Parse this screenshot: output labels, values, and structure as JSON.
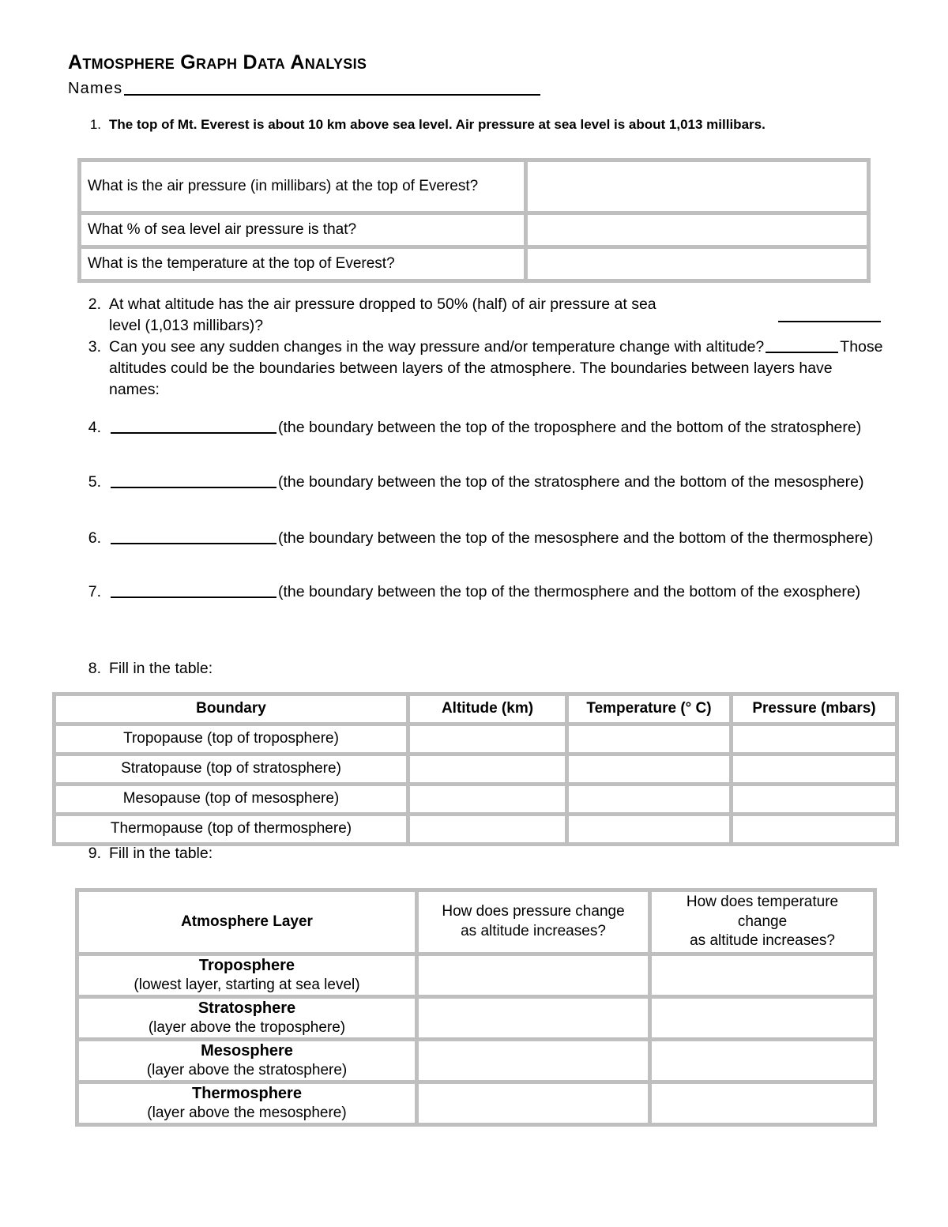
{
  "document": {
    "title": "Atmosphere Graph Data Analysis",
    "names_label": "Names"
  },
  "questions": {
    "q1": {
      "number": "1.",
      "text": "The top of Mt. Everest is about 10 km above sea level. Air pressure at sea level is about 1,013 millibars."
    },
    "q2": {
      "number": "2.",
      "line1": "At what altitude has the air pressure dropped to 50% (half) of air pressure at sea",
      "line2": "level (1,013 millibars)?"
    },
    "q3": {
      "number": "3.",
      "part1": "Can you see any sudden changes in the way pressure and/or temperature change with altitude?",
      "part2": "Those altitudes could be the boundaries between layers of the atmosphere. The boundaries between layers have names:"
    },
    "q4": {
      "number": "4.",
      "text": "(the boundary between the top of the troposphere and the bottom of the stratosphere)"
    },
    "q5": {
      "number": "5.",
      "text": "(the boundary between the top of the stratosphere and the bottom of the mesosphere)"
    },
    "q6": {
      "number": "6.",
      "text": "(the boundary between the top of the mesosphere and the bottom of the thermosphere)"
    },
    "q7": {
      "number": "7.",
      "text": "(the boundary between the top of the thermosphere and the bottom of the exosphere)"
    },
    "q8": {
      "number": "8.",
      "text": "Fill in the table:"
    },
    "q9": {
      "number": "9.",
      "text": "Fill in the table:"
    }
  },
  "everest_table": {
    "rows": [
      {
        "question": "What is the air pressure (in millibars) at the top of Everest?",
        "answer": ""
      },
      {
        "question": "What % of sea level air pressure is that?",
        "answer": ""
      },
      {
        "question": "What is the temperature at the top of Everest?",
        "answer": ""
      }
    ]
  },
  "boundary_table": {
    "headers": [
      "Boundary",
      "Altitude (km)",
      "Temperature (° C)",
      "Pressure (mbars)"
    ],
    "rows": [
      {
        "boundary": "Tropopause (top of troposphere)",
        "altitude": "",
        "temperature": "",
        "pressure": ""
      },
      {
        "boundary": "Stratopause (top of stratosphere)",
        "altitude": "",
        "temperature": "",
        "pressure": ""
      },
      {
        "boundary": "Mesopause (top of mesosphere)",
        "altitude": "",
        "temperature": "",
        "pressure": ""
      },
      {
        "boundary": "Thermopause (top of thermosphere)",
        "altitude": "",
        "temperature": "",
        "pressure": ""
      }
    ]
  },
  "layer_table": {
    "headers": {
      "layer": "Atmosphere Layer",
      "pressure_line1": "How does pressure change",
      "pressure_line2": "as altitude increases?",
      "temperature_line1": "How does temperature",
      "temperature_line2": "change",
      "temperature_line3": "as altitude increases?"
    },
    "rows": [
      {
        "name": "Troposphere",
        "detail": "(lowest layer, starting at sea level)",
        "pressure": "",
        "temperature": ""
      },
      {
        "name": "Stratosphere",
        "detail": "(layer above the troposphere)",
        "pressure": "",
        "temperature": ""
      },
      {
        "name": "Mesosphere",
        "detail": "(layer above the stratosphere)",
        "pressure": "",
        "temperature": ""
      },
      {
        "name": "Thermosphere",
        "detail": "(layer above the mesosphere)",
        "pressure": "",
        "temperature": ""
      }
    ]
  },
  "colors": {
    "table_frame": "#bfbfbf",
    "cell_background": "#ffffff",
    "text": "#000000"
  }
}
